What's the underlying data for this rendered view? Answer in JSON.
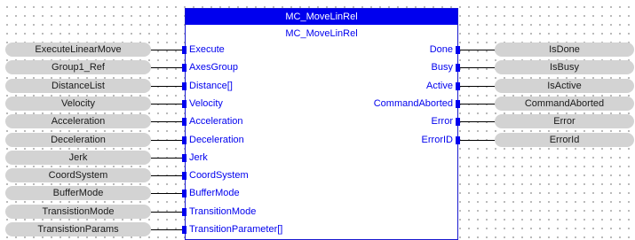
{
  "block": {
    "header": "MC_MoveLinRel",
    "subtitle": "MC_MoveLinRel"
  },
  "inputs": [
    {
      "variable": "ExecuteLinearMove",
      "pin": "Execute"
    },
    {
      "variable": "Group1_Ref",
      "pin": "AxesGroup"
    },
    {
      "variable": "DistanceList",
      "pin": "Distance[]"
    },
    {
      "variable": "Velocity",
      "pin": "Velocity"
    },
    {
      "variable": "Acceleration",
      "pin": "Acceleration"
    },
    {
      "variable": "Deceleration",
      "pin": "Deceleration"
    },
    {
      "variable": "Jerk",
      "pin": "Jerk"
    },
    {
      "variable": "CoordSystem",
      "pin": "CoordSystem"
    },
    {
      "variable": "BufferMode",
      "pin": "BufferMode"
    },
    {
      "variable": "TransistionMode",
      "pin": "TransitionMode"
    },
    {
      "variable": "TransistionParams",
      "pin": "TransitionParameter[]"
    }
  ],
  "outputs": [
    {
      "pin": "Done",
      "variable": "IsDone"
    },
    {
      "pin": "Busy",
      "variable": "IsBusy"
    },
    {
      "pin": "Active",
      "variable": "IsActive"
    },
    {
      "pin": "CommandAborted",
      "variable": "CommandAborted"
    },
    {
      "pin": "Error",
      "variable": "Error"
    },
    {
      "pin": "ErrorID",
      "variable": "ErrorId"
    }
  ],
  "colors": {
    "block_header": "#0000ee",
    "pin_text": "#0000ee",
    "variable_fill": "#d3d3d3"
  }
}
